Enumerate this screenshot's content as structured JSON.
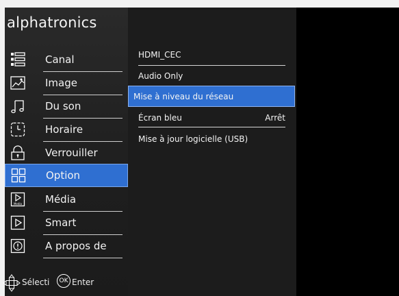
{
  "brand": "alphatronics",
  "menu": {
    "items": [
      {
        "label": "Canal",
        "icon": "list-icon"
      },
      {
        "label": "Image",
        "icon": "picture-icon"
      },
      {
        "label": "Du son",
        "icon": "music-note-icon"
      },
      {
        "label": "Horaire",
        "icon": "clock-icon"
      },
      {
        "label": "Verrouiller",
        "icon": "lock-icon"
      },
      {
        "label": "Option",
        "icon": "grid-icon"
      },
      {
        "label": "Média",
        "icon": "media-play-icon"
      },
      {
        "label": "Smart",
        "icon": "play-icon"
      },
      {
        "label": "A propos de",
        "icon": "info-icon"
      }
    ],
    "selected_index": 5,
    "media_icon_caption": "Media"
  },
  "hint": {
    "select_label": "Sélecti",
    "ok_badge": "OK",
    "enter_label": "Enter"
  },
  "submenu": {
    "items": [
      {
        "label": "HDMI_CEC",
        "value": ""
      },
      {
        "label": "Audio Only",
        "value": ""
      },
      {
        "label": "Mise à niveau du réseau",
        "value": ""
      },
      {
        "label": "Écran bleu",
        "value": "Arrêt"
      },
      {
        "label": "Mise à jour logicielle (USB)",
        "value": ""
      }
    ],
    "selected_index": 2
  },
  "colors": {
    "accent": "#2f6fd1",
    "sidebar_bg": "#222222",
    "submenu_bg": "#1c1c1c"
  }
}
